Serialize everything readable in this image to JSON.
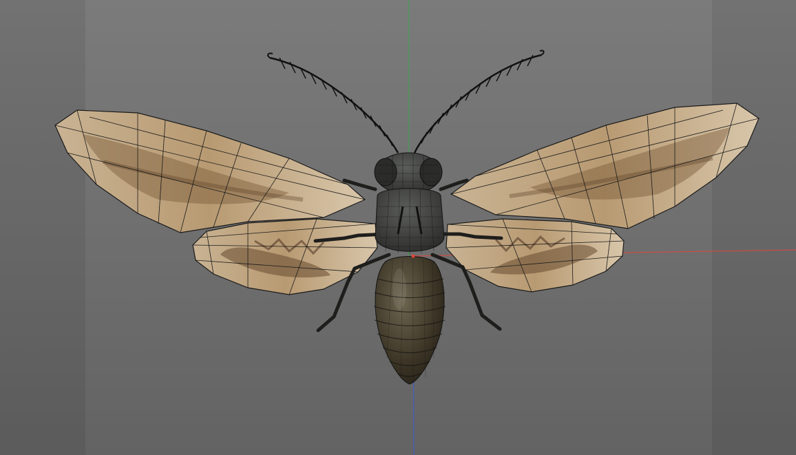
{
  "viewport": {
    "background_color": "#6e6e6e",
    "mode": "3d-perspective"
  },
  "axes": {
    "x_axis_color": "#e0463c",
    "y_axis_color": "#3aa94a",
    "z_axis_color": "#3b5bd8"
  },
  "model": {
    "subject": "moth",
    "wing_color": "#cdb79a",
    "wing_pattern_color": "#6b4f32",
    "body_color": "#3a3427",
    "wireframe_color": "#1a1a1a"
  },
  "icons": {
    "origin_marker": "world-origin-icon"
  }
}
